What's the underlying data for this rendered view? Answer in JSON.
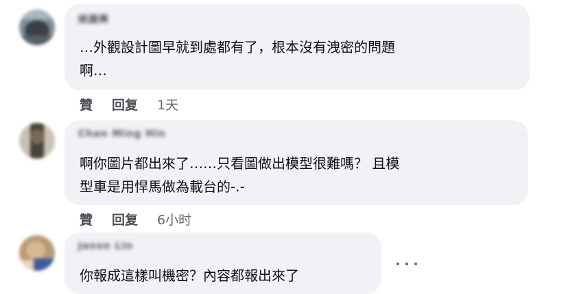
{
  "comments": [
    {
      "author": "姚國興",
      "lines": [
        "…外觀設計圖早就到處都有了，根本沒有洩密的問題",
        "啊…"
      ],
      "actions": {
        "like": "贊",
        "reply": "回复",
        "time": "1天"
      }
    },
    {
      "author": "Chan Ming Hin",
      "lines": [
        "啊你圖片都出來了……只看圖做出模型很難嗎？ 且模",
        "型車是用悍馬做為載台的-.-"
      ],
      "actions": {
        "like": "贊",
        "reply": "回复",
        "time": "6小时"
      }
    },
    {
      "author": "Jason Lin",
      "lines": [
        "你報成這樣叫機密？內容都報出來了"
      ]
    }
  ]
}
